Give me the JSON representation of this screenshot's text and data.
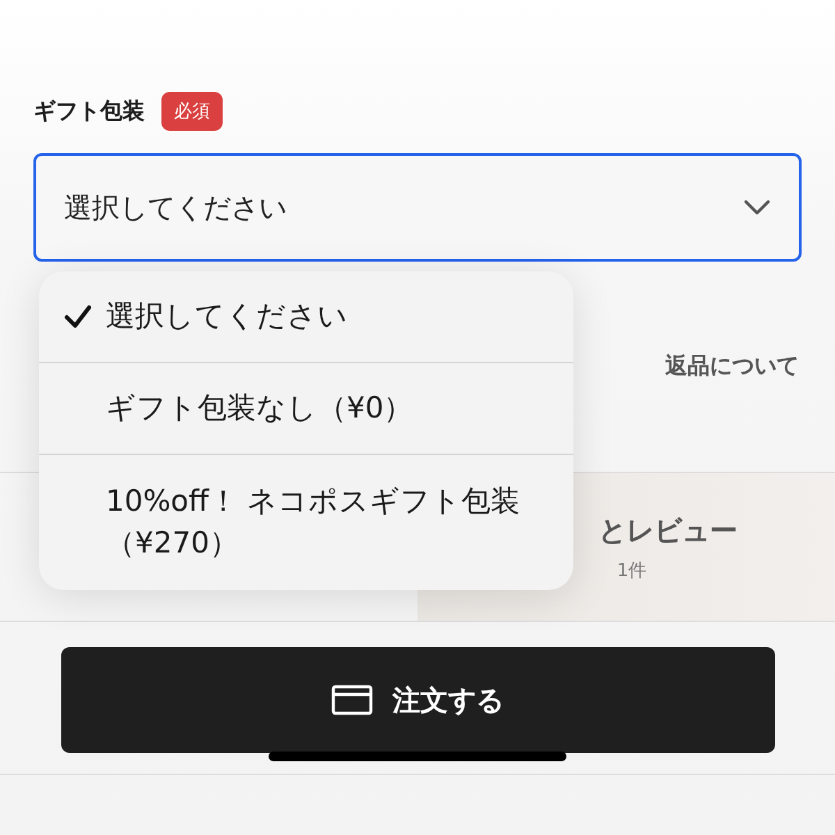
{
  "gift_wrap_field": {
    "label": "ギフト包装",
    "badge": "必須",
    "value": "選択してください"
  },
  "dropdown_menu": {
    "options": [
      {
        "label": "選択してください",
        "selected": true
      },
      {
        "label": "ギフト包装なし（¥0）",
        "selected": false
      },
      {
        "label": "10%off！ ネコポスギフト包装（¥270）",
        "selected": false
      }
    ]
  },
  "returns_link": "返品について",
  "review_panel": {
    "title": "とレビュー",
    "count": "1件"
  },
  "order_button": {
    "label": "注文する"
  }
}
